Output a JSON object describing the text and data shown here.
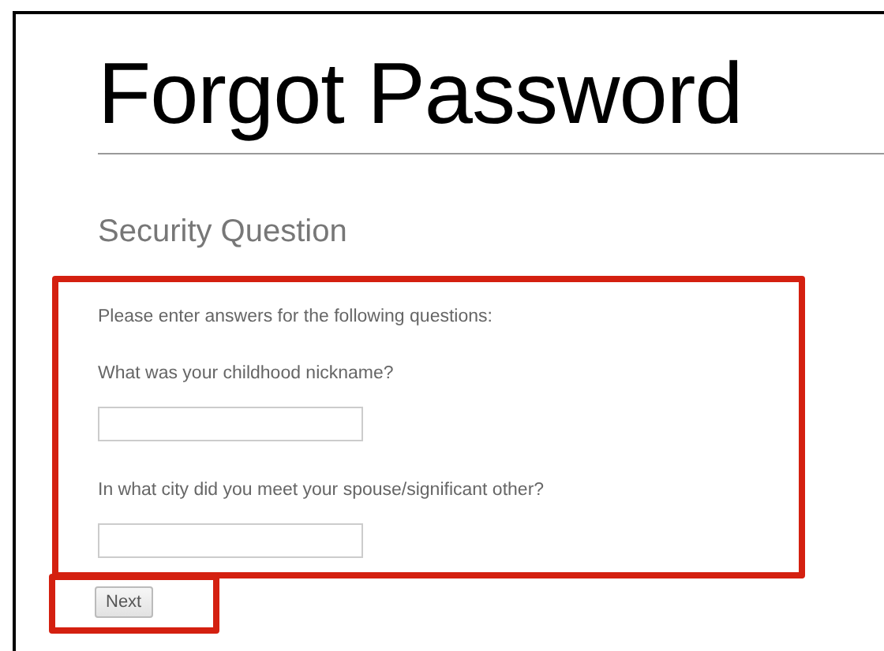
{
  "title": "Forgot Password",
  "section_title": "Security Question",
  "instructions": "Please enter answers for the following questions:",
  "questions": [
    {
      "label": "What was your childhood nickname?"
    },
    {
      "label": "In what city did you meet your spouse/significant other?"
    }
  ],
  "next_button": "Next"
}
